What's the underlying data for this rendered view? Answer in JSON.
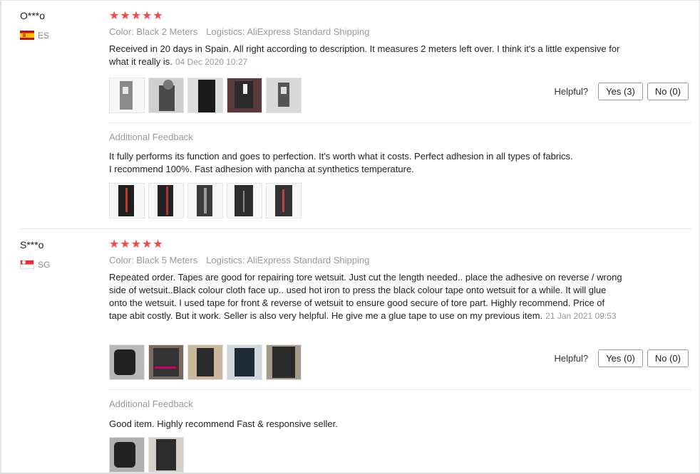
{
  "reviews": [
    {
      "user": "O***o",
      "country": "ES",
      "flag": "spain-flag",
      "rating": 5,
      "stars": "★★★★★",
      "color": "Color: Black 2 Meters",
      "logistics": "Logistics: AliExpress Standard Shipping",
      "text": "Received in 20 days in Spain. All right according to description. It measures 2 meters left over. I think it's a little expensive for what it really is.",
      "date": "04 Dec 2020 10:27",
      "helpful_label": "Helpful?",
      "yes_label": "Yes (3)",
      "no_label": "No (0)",
      "additional_title": "Additional Feedback",
      "additional_text_1": "It fully performs its function and goes to perfection. It's worth what it costs. Perfect adhesion in all types of fabrics.",
      "additional_text_2": "I recommend 100%. Fast adhesion with pancha at synthetics temperature."
    },
    {
      "user": "S***o",
      "country": "SG",
      "flag": "singapore-flag",
      "rating": 5,
      "stars": "★★★★★",
      "color": "Color: Black 5 Meters",
      "logistics": "Logistics: AliExpress Standard Shipping",
      "text": "Repeated order. Tapes are good for repairing tore wetsuit. Just cut the length needed.. place the adhesive on reverse / wrong side of wetsuit..Black colour cloth face up.. used hot iron to press the black colour tape onto wetsuit for a while. It will glue onto the wetsuit. I used tape for front & reverse of wetsuit to ensure good secure of tore part. Highly recommend. Price of tape abit costly. But it work. Seller is also very helpful. He give me a glue tape to use on my previous item.",
      "date": "21 Jan 2021 09:53",
      "helpful_label": "Helpful?",
      "yes_label": "Yes (0)",
      "no_label": "No (0)",
      "additional_title": "Additional Feedback",
      "additional_text_1": "Good item. Highly recommend Fast & responsive seller."
    }
  ],
  "colors": {
    "star": "#f24a4a",
    "muted_text": "#999999",
    "body_text": "#222222",
    "border": "#e5e5e5"
  }
}
